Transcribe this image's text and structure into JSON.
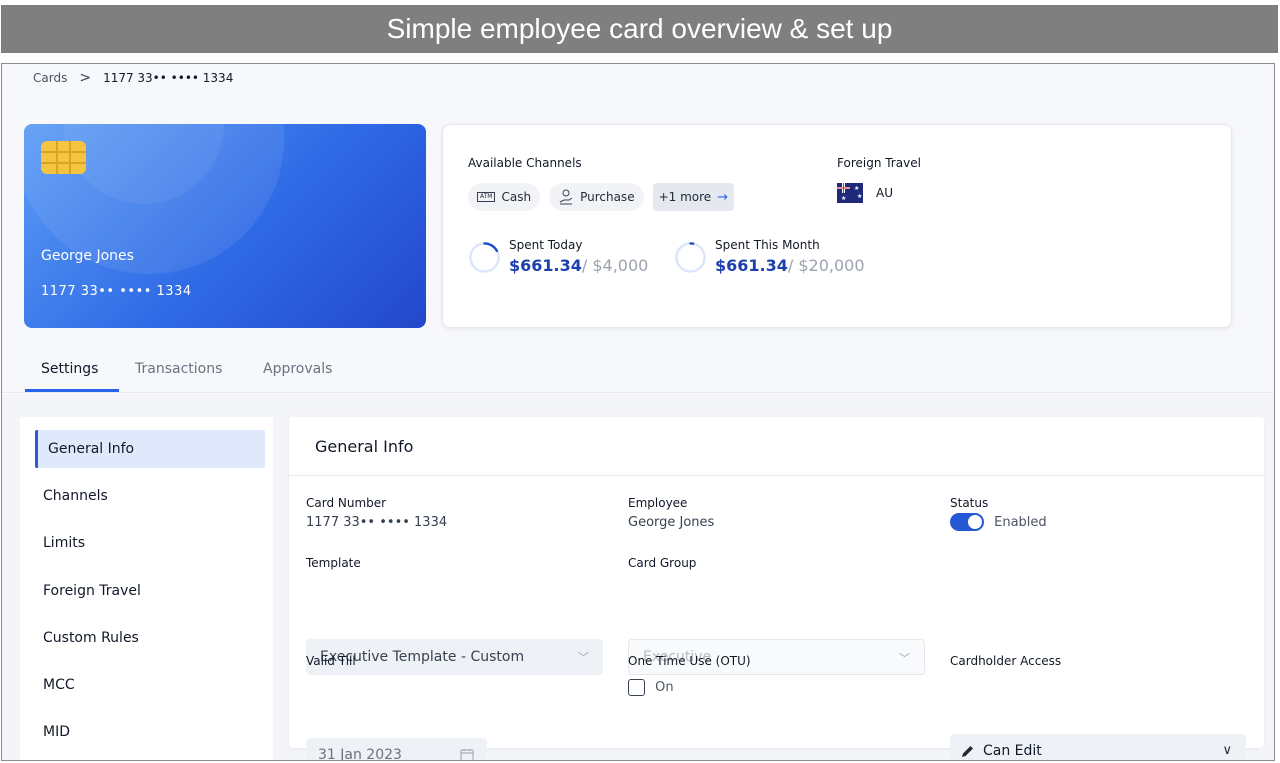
{
  "banner": {
    "title": "Simple employee card overview & set up"
  },
  "breadcrumb": {
    "root": "Cards",
    "current": "1177 33•• •••• 1334"
  },
  "card": {
    "holder": "George Jones",
    "number": "1177 33•• •••• 1334"
  },
  "channels": {
    "title": "Available Channels",
    "items": [
      {
        "label": "Cash",
        "icon": "atm-icon"
      },
      {
        "label": "Purchase",
        "icon": "hand-coin-icon"
      }
    ],
    "more": "+1 more"
  },
  "foreign_travel": {
    "title": "Foreign Travel",
    "country": "AU",
    "flag_icon": "australia-flag-icon"
  },
  "spending": [
    {
      "title": "Spent Today",
      "current": "$661.34",
      "limit": "/ $4,000",
      "progress": 0.17
    },
    {
      "title": "Spent This Month",
      "current": "$661.34",
      "limit": "/ $20,000",
      "progress": 0.03
    }
  ],
  "tabs": [
    "Settings",
    "Transactions",
    "Approvals"
  ],
  "sidenav": [
    "General Info",
    "Channels",
    "Limits",
    "Foreign Travel",
    "Custom Rules",
    "MCC",
    "MID"
  ],
  "panel": {
    "title": "General Info",
    "card_number": {
      "label": "Card Number",
      "value": "1177 33•• •••• 1334"
    },
    "employee": {
      "label": "Employee",
      "value": "George Jones"
    },
    "status": {
      "label": "Status",
      "value": "Enabled",
      "enabled": true
    },
    "template": {
      "label": "Template",
      "value": "Executive Template - Custom"
    },
    "card_group": {
      "label": "Card Group",
      "value": "Executive"
    },
    "valid_till": {
      "label": "Valid Till",
      "value": "31 Jan 2023"
    },
    "otu": {
      "label": "One Time Use (OTU)",
      "value": "On",
      "checked": false
    },
    "cardholder_access": {
      "label": "Cardholder Access",
      "value": "Can Edit"
    }
  },
  "colors": {
    "accent": "#2563eb",
    "card_start": "#5b9cf5",
    "card_end": "#2348c9",
    "amount": "#1e40af"
  }
}
